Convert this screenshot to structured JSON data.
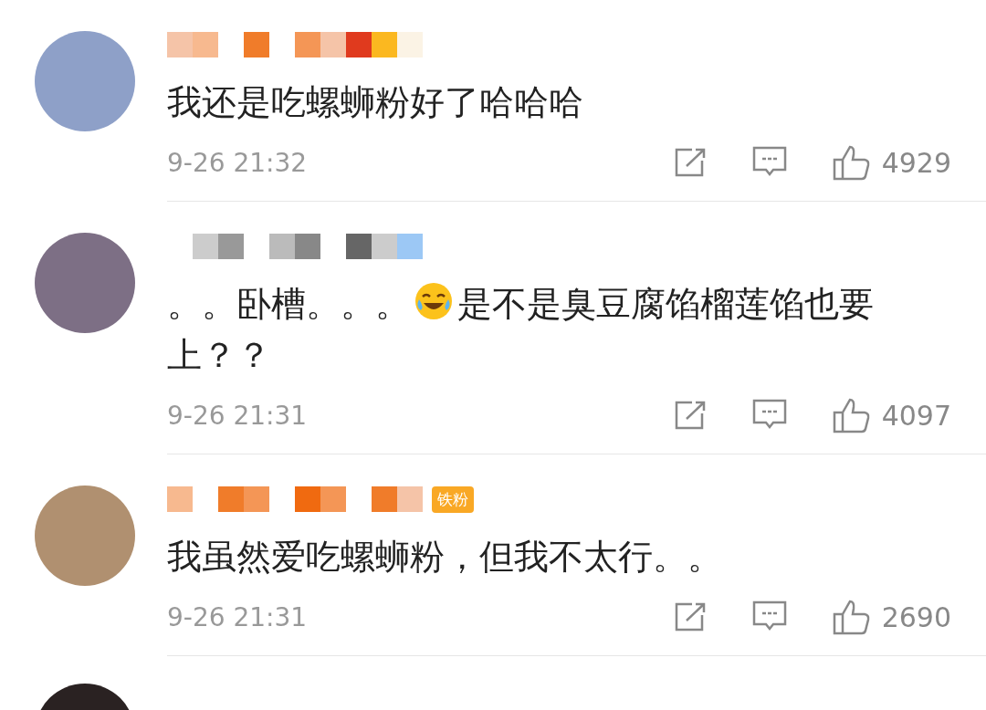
{
  "comments": [
    {
      "segments": [
        {
          "kind": "text",
          "text": "我还是吃螺蛳粉好了哈哈哈"
        }
      ],
      "time": "9-26 21:32",
      "likes": "4929"
    },
    {
      "segments": [
        {
          "kind": "text",
          "text": "。。卧槽。。。"
        },
        {
          "kind": "emoji"
        },
        {
          "kind": "text",
          "text": "是不是臭豆腐馅榴莲馅也要上？？"
        }
      ],
      "time": "9-26 21:31",
      "likes": "4097"
    },
    {
      "badge": "铁粉",
      "segments": [
        {
          "kind": "text",
          "text": "我虽然爱吃螺蛳粉，但我不太行。。"
        }
      ],
      "time": "9-26 21:31",
      "likes": "2690"
    }
  ],
  "more_below": true
}
